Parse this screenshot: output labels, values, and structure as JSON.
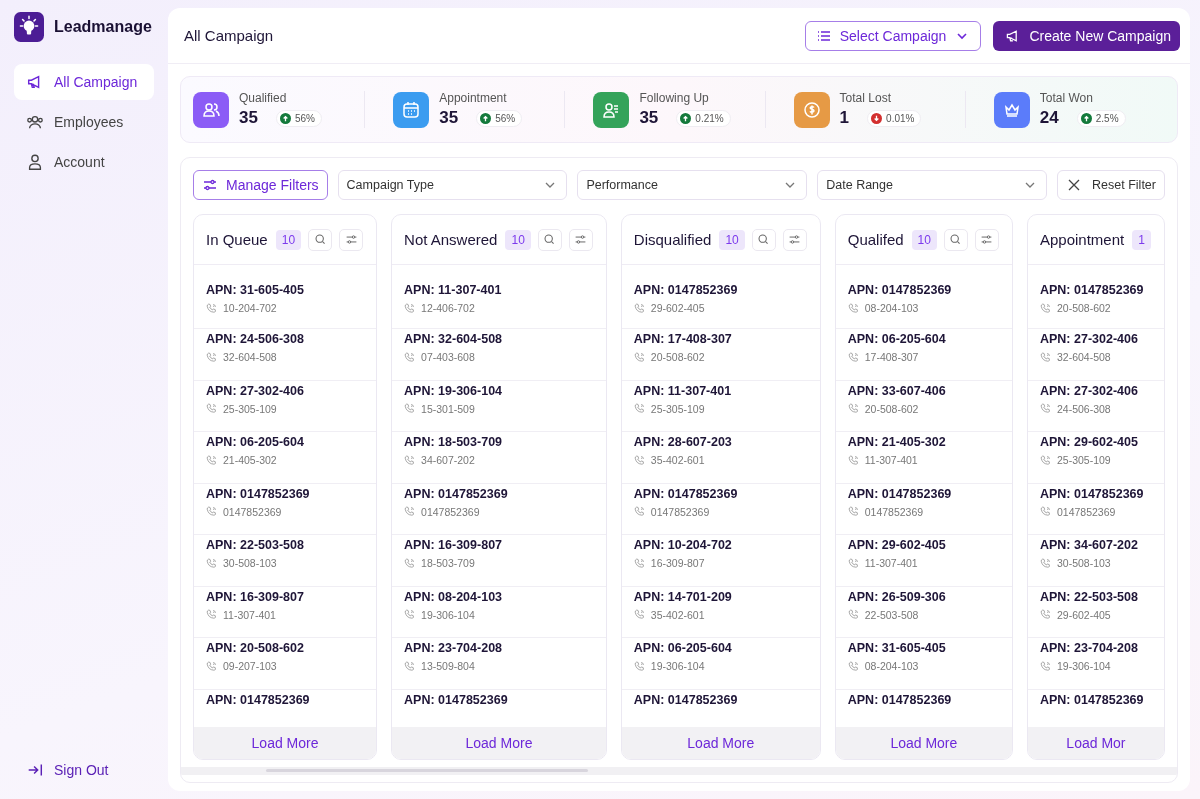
{
  "brand": {
    "name": "Leadmanage"
  },
  "sidebar": {
    "items": [
      {
        "label": "All Campaign",
        "selected": true
      },
      {
        "label": "Employees",
        "selected": false
      },
      {
        "label": "Account",
        "selected": false
      }
    ],
    "sign_out": "Sign Out"
  },
  "header": {
    "title": "All Campaign",
    "select_campaign": "Select Campaign",
    "create_button": "Create New Campaign"
  },
  "stats": [
    {
      "label": "Qualified",
      "value": "35",
      "change": "56%",
      "falling": false,
      "color": "#8b5cf6"
    },
    {
      "label": "Appointment",
      "value": "35",
      "change": "56%",
      "falling": false,
      "color": "#3b9cf0"
    },
    {
      "label": "Following Up",
      "value": "35",
      "change": "0.21%",
      "falling": false,
      "color": "#34a35a"
    },
    {
      "label": "Total Lost",
      "value": "1",
      "change": "0.01%",
      "falling": true,
      "color": "#e69a45"
    },
    {
      "label": "Total Won",
      "value": "24",
      "change": "2.5%",
      "falling": false,
      "color": "#5b7cfa"
    }
  ],
  "filters": {
    "manage": "Manage Filters",
    "dropdowns": [
      "Campaign Type",
      "Performance",
      "Date Range"
    ],
    "reset": "Reset Filter"
  },
  "columns": [
    {
      "title": "In Queue",
      "count": "10",
      "load_more": "Load More",
      "items": [
        {
          "apn": "APN: 31-605-405",
          "phone": "10-204-702"
        },
        {
          "apn": "APN: 24-506-308",
          "phone": "32-604-508"
        },
        {
          "apn": "APN: 27-302-406",
          "phone": "25-305-109"
        },
        {
          "apn": "APN: 06-205-604",
          "phone": "21-405-302"
        },
        {
          "apn": "APN: 0147852369",
          "phone": "0147852369"
        },
        {
          "apn": "APN: 22-503-508",
          "phone": "30-508-103"
        },
        {
          "apn": "APN: 16-309-807",
          "phone": "11-307-401"
        },
        {
          "apn": "APN: 20-508-602",
          "phone": "09-207-103"
        },
        {
          "apn": "APN: 0147852369"
        }
      ]
    },
    {
      "title": "Not Answered",
      "count": "10",
      "load_more": "Load More",
      "items": [
        {
          "apn": "APN: 11-307-401",
          "phone": "12-406-702"
        },
        {
          "apn": "APN: 32-604-508",
          "phone": "07-403-608"
        },
        {
          "apn": "APN: 19-306-104",
          "phone": "15-301-509"
        },
        {
          "apn": "APN: 18-503-709",
          "phone": "34-607-202"
        },
        {
          "apn": "APN: 0147852369",
          "phone": "0147852369"
        },
        {
          "apn": "APN: 16-309-807",
          "phone": "18-503-709"
        },
        {
          "apn": "APN: 08-204-103",
          "phone": "19-306-104"
        },
        {
          "apn": "APN: 23-704-208",
          "phone": "13-509-804"
        },
        {
          "apn": "APN: 0147852369"
        }
      ]
    },
    {
      "title": "Disqualified",
      "count": "10",
      "load_more": "Load More",
      "items": [
        {
          "apn": "APN: 0147852369",
          "phone": "29-602-405"
        },
        {
          "apn": "APN: 17-408-307",
          "phone": "20-508-602"
        },
        {
          "apn": "APN: 11-307-401",
          "phone": "25-305-109"
        },
        {
          "apn": "APN: 28-607-203",
          "phone": "35-402-601"
        },
        {
          "apn": "APN: 0147852369",
          "phone": "0147852369"
        },
        {
          "apn": "APN: 10-204-702",
          "phone": "16-309-807"
        },
        {
          "apn": "APN: 14-701-209",
          "phone": "35-402-601"
        },
        {
          "apn": "APN: 06-205-604",
          "phone": "19-306-104"
        },
        {
          "apn": "APN: 0147852369"
        }
      ]
    },
    {
      "title": "Qualifed",
      "count": "10",
      "load_more": "Load More",
      "items": [
        {
          "apn": "APN: 0147852369",
          "phone": "08-204-103"
        },
        {
          "apn": "APN: 06-205-604",
          "phone": "17-408-307"
        },
        {
          "apn": "APN: 33-607-406",
          "phone": "20-508-602"
        },
        {
          "apn": "APN: 21-405-302",
          "phone": "11-307-401"
        },
        {
          "apn": "APN: 0147852369",
          "phone": "0147852369"
        },
        {
          "apn": "APN: 29-602-405",
          "phone": "11-307-401"
        },
        {
          "apn": "APN: 26-509-306",
          "phone": "22-503-508"
        },
        {
          "apn": "APN: 31-605-405",
          "phone": "08-204-103"
        },
        {
          "apn": "APN: 0147852369"
        }
      ]
    },
    {
      "title": "Appointment",
      "count": "1",
      "load_more": "Load Mor",
      "items": [
        {
          "apn": "APN: 0147852369",
          "phone": "20-508-602"
        },
        {
          "apn": "APN: 27-302-406",
          "phone": "32-604-508"
        },
        {
          "apn": "APN: 27-302-406",
          "phone": "24-506-308"
        },
        {
          "apn": "APN: 29-602-405",
          "phone": "25-305-109"
        },
        {
          "apn": "APN: 0147852369",
          "phone": "0147852369"
        },
        {
          "apn": "APN: 34-607-202",
          "phone": "30-508-103"
        },
        {
          "apn": "APN: 22-503-508",
          "phone": "29-602-405"
        },
        {
          "apn": "APN: 23-704-208",
          "phone": "19-306-104"
        },
        {
          "apn": "APN: 0147852369"
        }
      ]
    }
  ]
}
